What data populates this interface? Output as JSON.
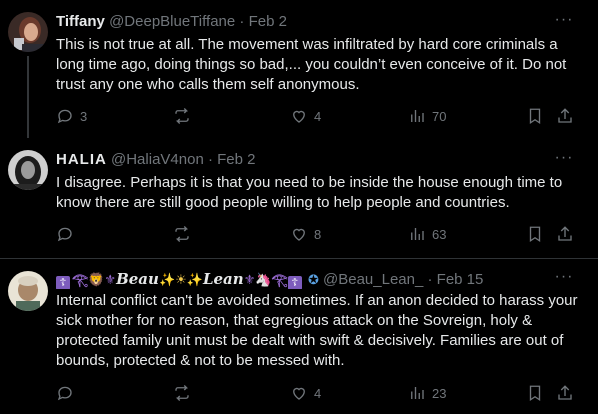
{
  "tweets": [
    {
      "name": "Tiffany",
      "handle": "@DeepBlueTiffane",
      "separator": "·",
      "date": "Feb 2",
      "text": "This is not true at all. The movement was infiltrated by hard core criminals a long time ago, doing things so bad,... you couldn’t even conceive of it. Do not trust any one who calls them self anonymous.",
      "replies": "3",
      "reposts": "",
      "likes": "4",
      "views": "70"
    },
    {
      "name": "HALIA",
      "handle": "@HaliaV4non",
      "separator": "·",
      "date": "Feb 2",
      "text": "I disagree. Perhaps it is that you need to be inside the house enough time to know  there are still good people willing to help people and countries.",
      "replies": "",
      "reposts": "",
      "likes": "8",
      "views": "63"
    },
    {
      "name_word_1": "Beau",
      "name_word_2": "Lean",
      "handle": "@Beau_Lean_",
      "separator": "·",
      "date": "Feb 15",
      "text": "Internal conflict can't be avoided sometimes. If an anon decided to harass your sick mother for no reason, that egregious attack on the Sovreign, holy & protected family unit must be dealt with swift & decisively. Families are out of bounds, protected & not to be messed with.",
      "replies": "",
      "reposts": "",
      "likes": "4",
      "views": "23"
    }
  ],
  "more_label": "···",
  "colors": {
    "background": "#000000",
    "text": "#e7e9ea",
    "muted": "#71767b",
    "divider": "#2f3336"
  },
  "icons": [
    "reply-icon",
    "repost-icon",
    "like-icon",
    "views-icon",
    "bookmark-icon",
    "share-icon",
    "more-icon"
  ]
}
